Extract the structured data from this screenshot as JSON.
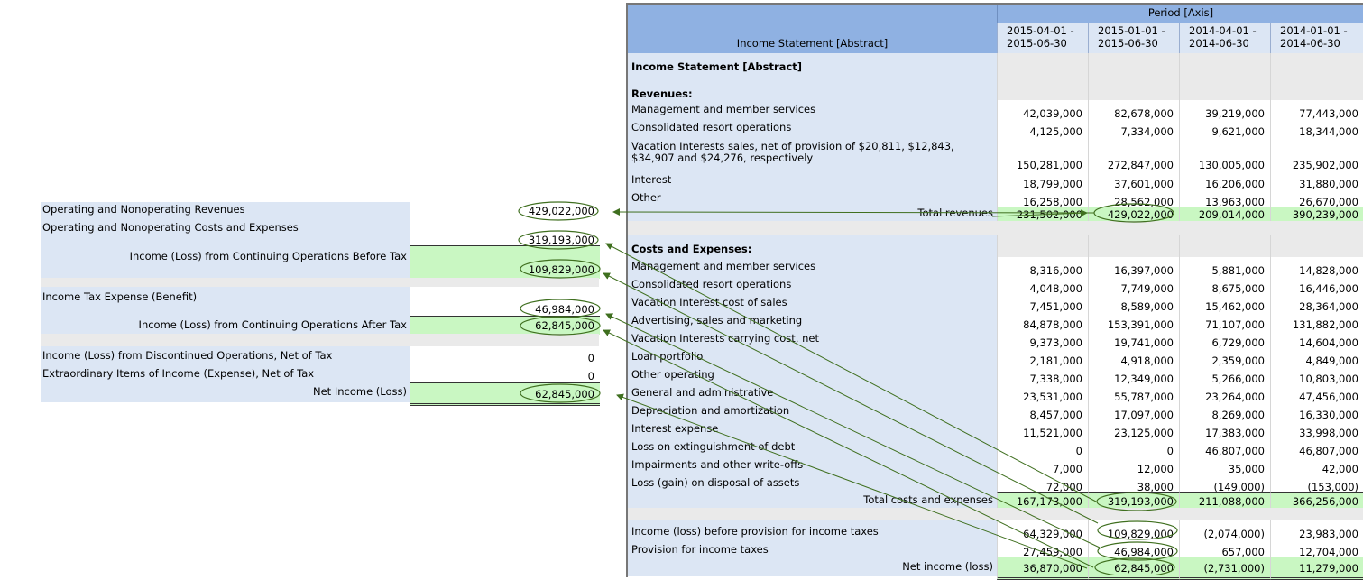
{
  "summary": {
    "rows": [
      {
        "label": "Operating and Nonoperating Revenues",
        "value": "429,022,000"
      },
      {
        "label": "Operating and Nonoperating Costs and Expenses",
        "value": "319,193,000"
      },
      {
        "label": "Income (Loss) from Continuing Operations Before Tax",
        "value": "109,829,000"
      },
      {
        "label": "Income Tax Expense (Benefit)",
        "value": "46,984,000"
      },
      {
        "label": "Income (Loss) from Continuing Operations After Tax",
        "value": "62,845,000"
      },
      {
        "label": "Income (Loss) from Discontinued Operations, Net of Tax",
        "value": "0"
      },
      {
        "label": "Extraordinary Items of Income (Expense), Net of Tax",
        "value": "0"
      },
      {
        "label": "Net Income (Loss)",
        "value": "62,845,000"
      }
    ]
  },
  "statement": {
    "header_left": "Income Statement [Abstract]",
    "header_axis": "Period [Axis]",
    "columns": [
      "2015-04-01 -\n2015-06-30",
      "2015-01-01 -\n2015-06-30",
      "2014-04-01 -\n2014-06-30",
      "2014-01-01 -\n2014-06-30"
    ],
    "rows": [
      {
        "label": "Income Statement [Abstract]",
        "values": [
          "",
          "",
          "",
          ""
        ]
      },
      {
        "label": "Revenues:",
        "values": [
          "",
          "",
          "",
          ""
        ]
      },
      {
        "label": "Management and member services",
        "values": [
          "42,039,000",
          "82,678,000",
          "39,219,000",
          "77,443,000"
        ]
      },
      {
        "label": "Consolidated resort operations",
        "values": [
          "4,125,000",
          "7,334,000",
          "9,621,000",
          "18,344,000"
        ]
      },
      {
        "label": "Vacation Interests sales, net of provision of $20,811, $12,843,\n$34,907 and $24,276, respectively",
        "values": [
          "150,281,000",
          "272,847,000",
          "130,005,000",
          "235,902,000"
        ]
      },
      {
        "label": "Interest",
        "values": [
          "18,799,000",
          "37,601,000",
          "16,206,000",
          "31,880,000"
        ]
      },
      {
        "label": "Other",
        "values": [
          "16,258,000",
          "28,562,000",
          "13,963,000",
          "26,670,000"
        ]
      },
      {
        "label": "Total revenues",
        "values": [
          "231,502,000",
          "429,022,000",
          "209,014,000",
          "390,239,000"
        ]
      },
      {
        "label": "Costs and Expenses:",
        "values": [
          "",
          "",
          "",
          ""
        ]
      },
      {
        "label": "Management and member services",
        "values": [
          "8,316,000",
          "16,397,000",
          "5,881,000",
          "14,828,000"
        ]
      },
      {
        "label": "Consolidated resort operations",
        "values": [
          "4,048,000",
          "7,749,000",
          "8,675,000",
          "16,446,000"
        ]
      },
      {
        "label": "Vacation Interest cost of sales",
        "values": [
          "7,451,000",
          "8,589,000",
          "15,462,000",
          "28,364,000"
        ]
      },
      {
        "label": "Advertising, sales and marketing",
        "values": [
          "84,878,000",
          "153,391,000",
          "71,107,000",
          "131,882,000"
        ]
      },
      {
        "label": "Vacation Interests carrying cost, net",
        "values": [
          "9,373,000",
          "19,741,000",
          "6,729,000",
          "14,604,000"
        ]
      },
      {
        "label": "Loan portfolio",
        "values": [
          "2,181,000",
          "4,918,000",
          "2,359,000",
          "4,849,000"
        ]
      },
      {
        "label": "Other operating",
        "values": [
          "7,338,000",
          "12,349,000",
          "5,266,000",
          "10,803,000"
        ]
      },
      {
        "label": "General and administrative",
        "values": [
          "23,531,000",
          "55,787,000",
          "23,264,000",
          "47,456,000"
        ]
      },
      {
        "label": "Depreciation and amortization",
        "values": [
          "8,457,000",
          "17,097,000",
          "8,269,000",
          "16,330,000"
        ]
      },
      {
        "label": "Interest expense",
        "values": [
          "11,521,000",
          "23,125,000",
          "17,383,000",
          "33,998,000"
        ]
      },
      {
        "label": "Loss on extinguishment of debt",
        "values": [
          "0",
          "0",
          "46,807,000",
          "46,807,000"
        ]
      },
      {
        "label": "Impairments and other write-offs",
        "values": [
          "7,000",
          "12,000",
          "35,000",
          "42,000"
        ]
      },
      {
        "label": "Loss (gain) on disposal of assets",
        "values": [
          "72,000",
          "38,000",
          "(149,000)",
          "(153,000)"
        ]
      },
      {
        "label": "Total costs and expenses",
        "values": [
          "167,173,000",
          "319,193,000",
          "211,088,000",
          "366,256,000"
        ]
      },
      {
        "label": "Income (loss) before provision for income taxes",
        "values": [
          "64,329,000",
          "109,829,000",
          "(2,074,000)",
          "23,983,000"
        ]
      },
      {
        "label": "Provision for income taxes",
        "values": [
          "27,459,000",
          "46,984,000",
          "657,000",
          "12,704,000"
        ]
      },
      {
        "label": "Net income (loss)",
        "values": [
          "36,870,000",
          "62,845,000",
          "(2,731,000)",
          "11,279,000"
        ]
      }
    ]
  },
  "colors": {
    "header": "#8fb1e2",
    "label_bg": "#dce6f4",
    "highlight": "#c9f7c2",
    "arrow": "#3f6f1f"
  }
}
